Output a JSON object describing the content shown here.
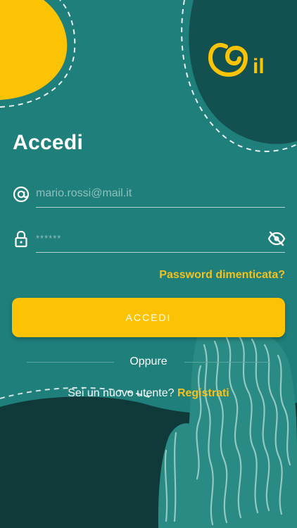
{
  "brand": {
    "logo_text": "il",
    "yellow": "#fbc304",
    "teal": "#1f7f7b",
    "dark_teal": "#0f3a39"
  },
  "login": {
    "title": "Accedi",
    "email": {
      "placeholder": "mario.rossi@mail.it",
      "icon": "at-icon"
    },
    "password": {
      "placeholder": "******",
      "icon": "lock-icon",
      "toggle_icon": "eye-off-icon"
    },
    "forgot_label": "Password dimenticata?",
    "submit_label": "ACCEDI",
    "divider_label": "Oppure",
    "register_prompt": "Sei un nuovo utente?",
    "register_link": "Registrati"
  }
}
